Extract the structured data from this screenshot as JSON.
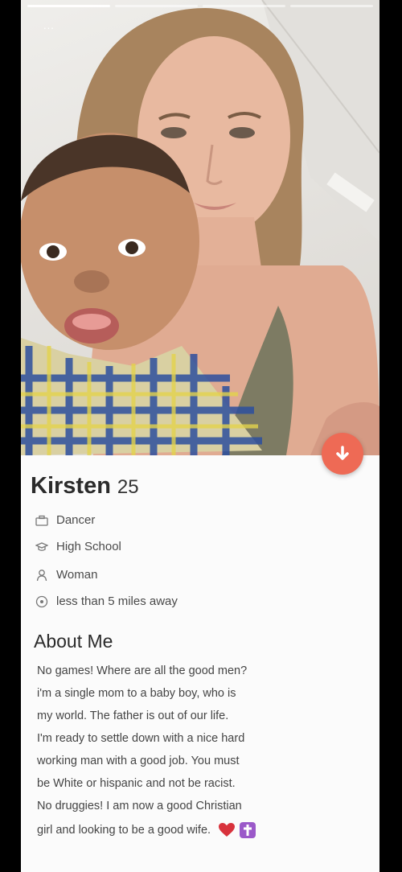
{
  "profile": {
    "name": "Kirsten",
    "age": "25",
    "details": [
      {
        "icon": "briefcase-icon",
        "text": "Dancer"
      },
      {
        "icon": "graduation-cap-icon",
        "text": "High School"
      },
      {
        "icon": "person-icon",
        "text": "Woman"
      },
      {
        "icon": "location-pin-icon",
        "text": "less than 5 miles away"
      }
    ]
  },
  "about": {
    "title": "About Me",
    "lines": [
      "No games! Where are all the good men?",
      "i'm a single mom to a baby boy, who is",
      "my world. The father is out of our life.",
      "I'm ready to settle down with a nice hard",
      "working man with a good job. You must",
      "be White or hispanic and not be racist.",
      "No druggies! I am now a good Christian",
      "girl and looking to be a good wife."
    ],
    "emojis": [
      "heart-emoji",
      "latin-cross-emoji"
    ]
  },
  "photo": {
    "indicator": "...",
    "page_count": 4,
    "active_page": 1
  },
  "colors": {
    "accent": "#ee6a55",
    "text": "#2b2b2b",
    "background": "#fbfbfb"
  }
}
